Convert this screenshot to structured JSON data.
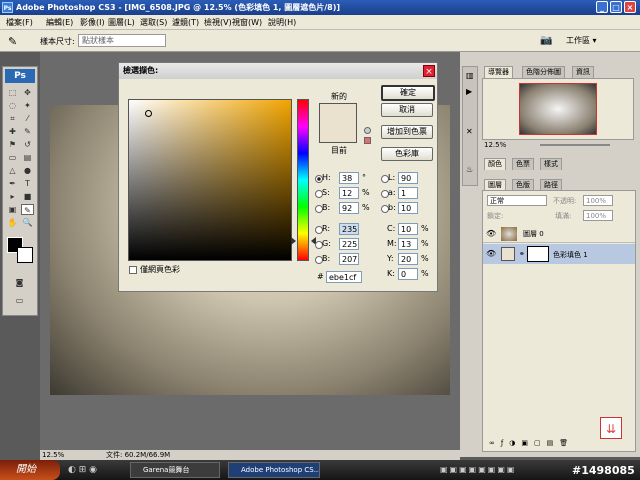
{
  "window": {
    "title": "Adobe Photoshop CS3 - [IMG_6508.JPG @ 12.5% (色彩填色 1, 圖層遮色片/8)]"
  },
  "menu": [
    "檔案(F)",
    "編輯(E)",
    "影像(I)",
    "圖層(L)",
    "選取(S)",
    "濾鏡(T)",
    "檢視(V)",
    "視窗(W)",
    "說明(H)"
  ],
  "options": {
    "sample_label": "樣本尺寸:",
    "sample_value": "點狀樣本",
    "workspace_label": "工作區 ▾"
  },
  "dialog": {
    "title": "檢選擷色:",
    "new_label": "新的",
    "current_label": "目前",
    "buttons": {
      "ok": "確定",
      "cancel": "取消",
      "add_swatch": "增加到色票",
      "libraries": "色彩庫"
    },
    "hsb": {
      "h": "38",
      "h_unit": "°",
      "s": "12",
      "s_unit": "%",
      "b": "92",
      "b_unit": "%"
    },
    "rgb": {
      "r": "235",
      "g": "225",
      "b": "207"
    },
    "lab": {
      "l": "90",
      "a": "1",
      "b": "10"
    },
    "cmyk": {
      "c": "10",
      "m": "13",
      "y": "20",
      "k": "0",
      "unit": "%"
    },
    "hex": "ebe1cf",
    "web_only": "僅網頁色彩",
    "labels": {
      "H": "H:",
      "S": "S:",
      "B": "B:",
      "R": "R:",
      "G": "G:",
      "Bv": "B:",
      "L": "L:",
      "a": "a:",
      "b": "b:",
      "C": "C:",
      "M": "M:",
      "Y": "Y:",
      "K": "K:",
      "hash": "#"
    }
  },
  "panels": {
    "navigator_tabs": [
      "導覽器",
      "色階分佈圖",
      "資訊"
    ],
    "zoom": "12.5%",
    "color_tabs": [
      "顏色",
      "色票",
      "樣式"
    ],
    "layer_tabs": [
      "圖層",
      "色版",
      "路徑"
    ],
    "blend_mode": "正常",
    "opacity_label": "不透明:",
    "opacity": "100%",
    "fill_label": "填滿:",
    "fill": "100%",
    "lock_label": "鎖定:",
    "layers": [
      {
        "name": "圖層 0"
      },
      {
        "name": "色彩填色 1"
      }
    ]
  },
  "status": {
    "zoom": "12.5%",
    "doc": "文件: 60.2M/66.9M"
  },
  "taskbar": {
    "start": "開始",
    "tasks": [
      "Garena競舞台",
      "Adobe Photoshop CS..."
    ],
    "id_text": "#1498085"
  }
}
